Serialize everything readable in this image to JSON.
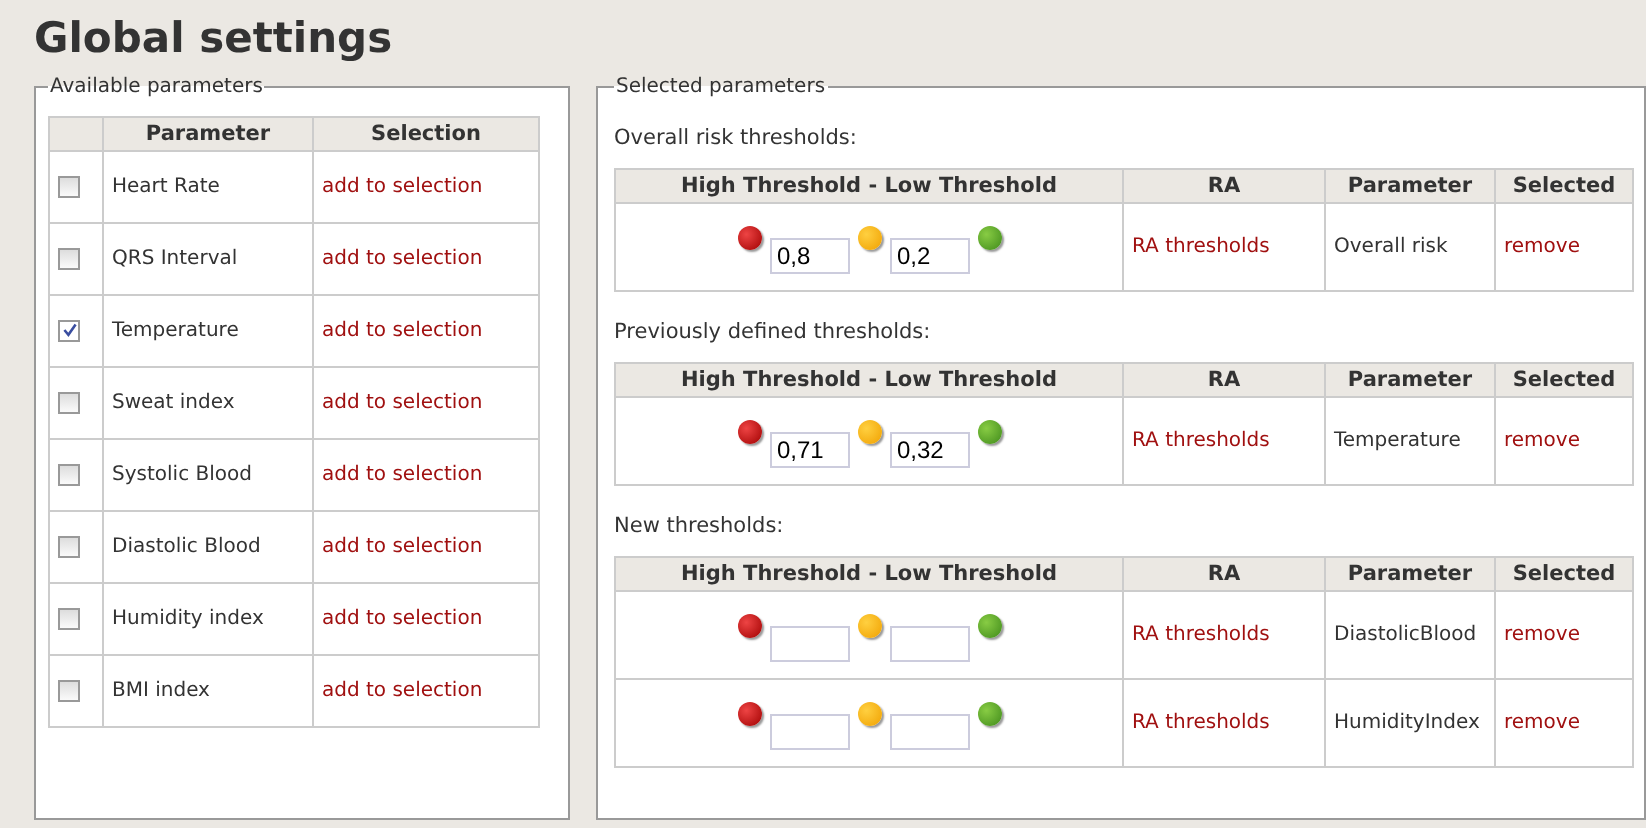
{
  "title": "Global settings",
  "available": {
    "legend": "Available parameters",
    "columns": [
      "Parameter",
      "Selection"
    ],
    "rows": [
      {
        "checked": false,
        "parameter": "Heart Rate",
        "action": "add to selection"
      },
      {
        "checked": false,
        "parameter": "QRS Interval",
        "action": "add to selection"
      },
      {
        "checked": true,
        "parameter": "Temperature",
        "action": "add to selection"
      },
      {
        "checked": false,
        "parameter": "Sweat index",
        "action": "add to selection"
      },
      {
        "checked": false,
        "parameter": "Systolic Blood",
        "action": "add to selection"
      },
      {
        "checked": false,
        "parameter": "Diastolic Blood",
        "action": "add to selection"
      },
      {
        "checked": false,
        "parameter": "Humidity index",
        "action": "add to selection"
      },
      {
        "checked": false,
        "parameter": "BMI index",
        "action": "add to selection"
      }
    ]
  },
  "selected": {
    "legend": "Selected parameters",
    "sections": [
      {
        "heading": "Overall risk thresholds:",
        "columns": [
          "High Threshold - Low Threshold",
          "RA",
          "Parameter",
          "Selected"
        ],
        "rows": [
          {
            "high": "0,8",
            "low": "0,2",
            "ra": "RA thresholds",
            "parameter": "Overall risk",
            "action": "remove"
          }
        ]
      },
      {
        "heading": "Previously defined thresholds:",
        "columns": [
          "High Threshold - Low Threshold",
          "RA",
          "Parameter",
          "Selected"
        ],
        "rows": [
          {
            "high": "0,71",
            "low": "0,32",
            "ra": "RA thresholds",
            "parameter": "Temperature",
            "action": "remove"
          }
        ]
      },
      {
        "heading": "New thresholds:",
        "columns": [
          "High Threshold - Low Threshold",
          "RA",
          "Parameter",
          "Selected"
        ],
        "rows": [
          {
            "ra": "RA thresholds",
            "parameter": "DiastolicBlood",
            "action": "remove"
          },
          {
            "ra": "RA thresholds",
            "parameter": "HumidityIndex",
            "action": "remove"
          }
        ]
      }
    ]
  }
}
